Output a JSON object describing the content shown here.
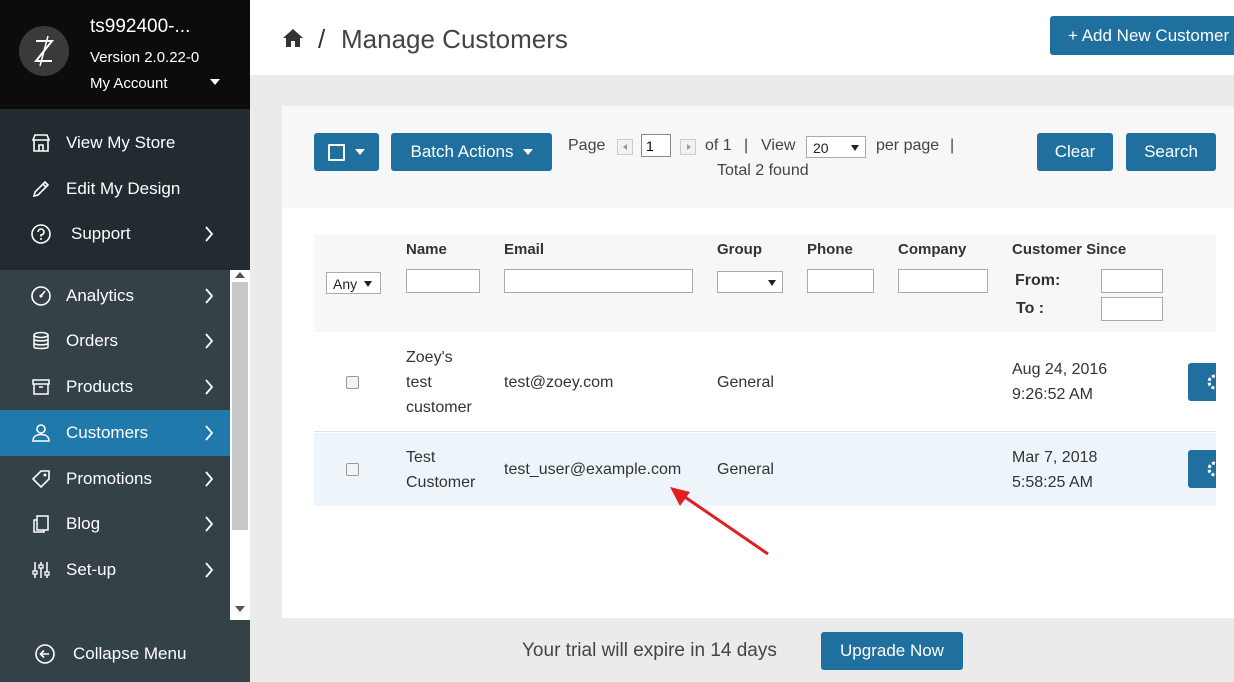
{
  "account": {
    "store_name": "ts992400-...",
    "version": "Version 2.0.22-0",
    "my_account": "My Account"
  },
  "sidebar": {
    "top_items": [
      {
        "label": "View My Store",
        "icon": "store-icon"
      },
      {
        "label": "Edit My Design",
        "icon": "pencil-icon"
      },
      {
        "label": "Support",
        "icon": "question-circle-icon"
      }
    ],
    "items": [
      {
        "label": "Analytics",
        "icon": "dashboard-gauge-icon"
      },
      {
        "label": "Orders",
        "icon": "database-icon"
      },
      {
        "label": "Products",
        "icon": "archive-box-icon"
      },
      {
        "label": "Customers",
        "icon": "user-icon",
        "active": true
      },
      {
        "label": "Promotions",
        "icon": "tag-icon"
      },
      {
        "label": "Blog",
        "icon": "document-copy-icon"
      },
      {
        "label": "Set-up",
        "icon": "sliders-icon"
      }
    ],
    "collapse_label": "Collapse Menu"
  },
  "header": {
    "breadcrumb_sep": "/",
    "title": "Manage Customers",
    "add_button": "+ Add New Customer"
  },
  "toolbar": {
    "batch_actions": "Batch Actions",
    "page_label": "Page",
    "page_value": "1",
    "of_label": "of 1",
    "view_label": "View",
    "per_page_value": "20",
    "per_page_label": "per page",
    "pipe": "|",
    "total_found": "Total 2 found",
    "clear_button": "Clear",
    "search_button": "Search"
  },
  "table": {
    "columns": [
      "Name",
      "Email",
      "Group",
      "Phone",
      "Company",
      "Customer Since"
    ],
    "filters": {
      "any_select": "Any",
      "from_label": "From:",
      "to_label": "To :"
    },
    "rows": [
      {
        "name_lines": [
          "Zoey's",
          "test",
          "customer"
        ],
        "email": "test@zoey.com",
        "group": "General",
        "phone": "",
        "company": "",
        "since_date": "Aug 24, 2016",
        "since_time": "9:26:52 AM"
      },
      {
        "name_lines": [
          "Test",
          "Customer"
        ],
        "email": "test_user@example.com",
        "group": "General",
        "phone": "",
        "company": "",
        "since_date": "Mar 7, 2018",
        "since_time": "5:58:25 AM"
      }
    ]
  },
  "trial": {
    "message": "Your trial will expire in 14 days",
    "upgrade_button": "Upgrade Now"
  },
  "colors": {
    "primary": "#1f6f9f",
    "sidebar_bg": "#344247",
    "sidebar_active": "#1f7aab",
    "annotation_arrow": "#e02020"
  }
}
